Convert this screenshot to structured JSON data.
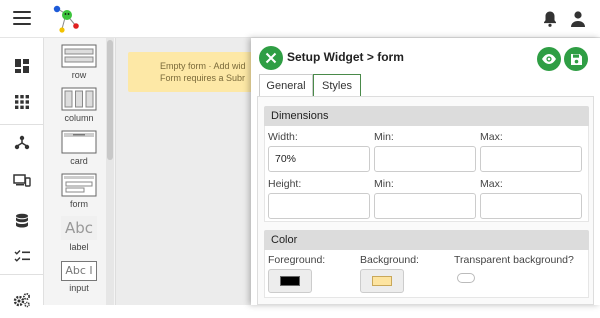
{
  "colors": {
    "accent": "#2f9e44",
    "note_bg": "#fde8a6",
    "foreground_swatch": "#000000",
    "background_swatch": "#fde4a0"
  },
  "topbar": {
    "menu_icon": "hamburger-icon",
    "logo_icon": "app-logo-icon",
    "notifications_icon": "bell-icon",
    "account_icon": "user-icon"
  },
  "leftnav": {
    "items": [
      {
        "icon": "dashboard-icon"
      },
      {
        "icon": "apps-grid-icon"
      },
      {
        "icon": "workflow-icon"
      },
      {
        "icon": "devices-icon"
      },
      {
        "icon": "database-icon"
      },
      {
        "icon": "checklist-icon"
      },
      {
        "icon": "settings-gears-icon"
      }
    ]
  },
  "palette": {
    "widgets": [
      {
        "label": "row",
        "icon": "row-widget-icon"
      },
      {
        "label": "column",
        "icon": "column-widget-icon"
      },
      {
        "label": "card",
        "icon": "card-widget-icon"
      },
      {
        "label": "form",
        "icon": "form-widget-icon"
      },
      {
        "label": "label",
        "icon": "label-widget-icon",
        "glyph": "Abc"
      },
      {
        "label": "input",
        "icon": "input-widget-icon",
        "glyph": "Abc I"
      }
    ]
  },
  "canvas": {
    "empty_line1": "Empty form · Add wid",
    "empty_line2": "Form requires a Subr"
  },
  "dialog": {
    "title": "Setup Widget > form",
    "tabs": [
      {
        "label": "General"
      },
      {
        "label": "Styles"
      }
    ],
    "active_tab": "Styles",
    "dimensions": {
      "heading": "Dimensions",
      "width_label": "Width:",
      "width_value": "70%",
      "min_label": "Min:",
      "min_value": "",
      "max_label": "Max:",
      "max_value": "",
      "height_label": "Height:",
      "height_value": "",
      "height_min_label": "Min:",
      "height_min_value": "",
      "height_max_label": "Max:",
      "height_max_value": ""
    },
    "color": {
      "heading": "Color",
      "foreground_label": "Foreground:",
      "background_label": "Background:",
      "transparent_label": "Transparent background?"
    }
  }
}
